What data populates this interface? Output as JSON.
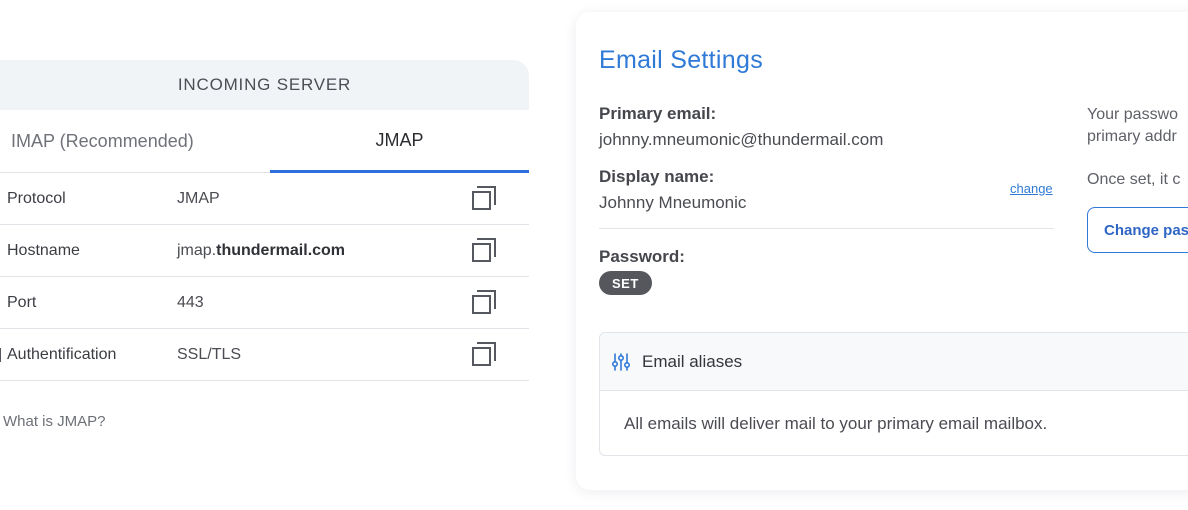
{
  "incoming_server": {
    "header": "INCOMING SERVER",
    "tabs": [
      {
        "label": "IMAP (Recommended)",
        "active": false
      },
      {
        "label": "JMAP",
        "active": true
      }
    ],
    "rows": [
      {
        "label": "Protocol",
        "value_prefix": "JMAP",
        "value_bold": ""
      },
      {
        "label": "Hostname",
        "value_prefix": "jmap.",
        "value_bold": "thundermail.com"
      },
      {
        "label": "Port",
        "value_prefix": "443",
        "value_bold": ""
      },
      {
        "label": "Authentification",
        "value_prefix": "SSL/TLS",
        "value_bold": ""
      }
    ],
    "help_link": "What is JMAP?",
    "copy_icon": "copy-icon"
  },
  "email_settings": {
    "title": "Email Settings",
    "primary_email_label": "Primary email:",
    "primary_email_value": "johnny.mneumonic@thundermail.com",
    "display_name_label": "Display name:",
    "display_name_value": "Johnny Mneumonic",
    "change_link": "change",
    "password_label": "Password:",
    "password_badge": "SET",
    "side_text_line1": "Your passwo",
    "side_text_line2": "primary addr",
    "side_text_line3": "Once set, it c",
    "change_password_button": "Change pas",
    "aliases": {
      "title": "Email aliases",
      "icon": "sliders-icon",
      "body": "All emails will deliver mail to your primary email mailbox."
    }
  },
  "colors": {
    "accent": "#2f7ad6",
    "tab_underline": "#2f6fdb",
    "badge_bg": "#55575d"
  }
}
